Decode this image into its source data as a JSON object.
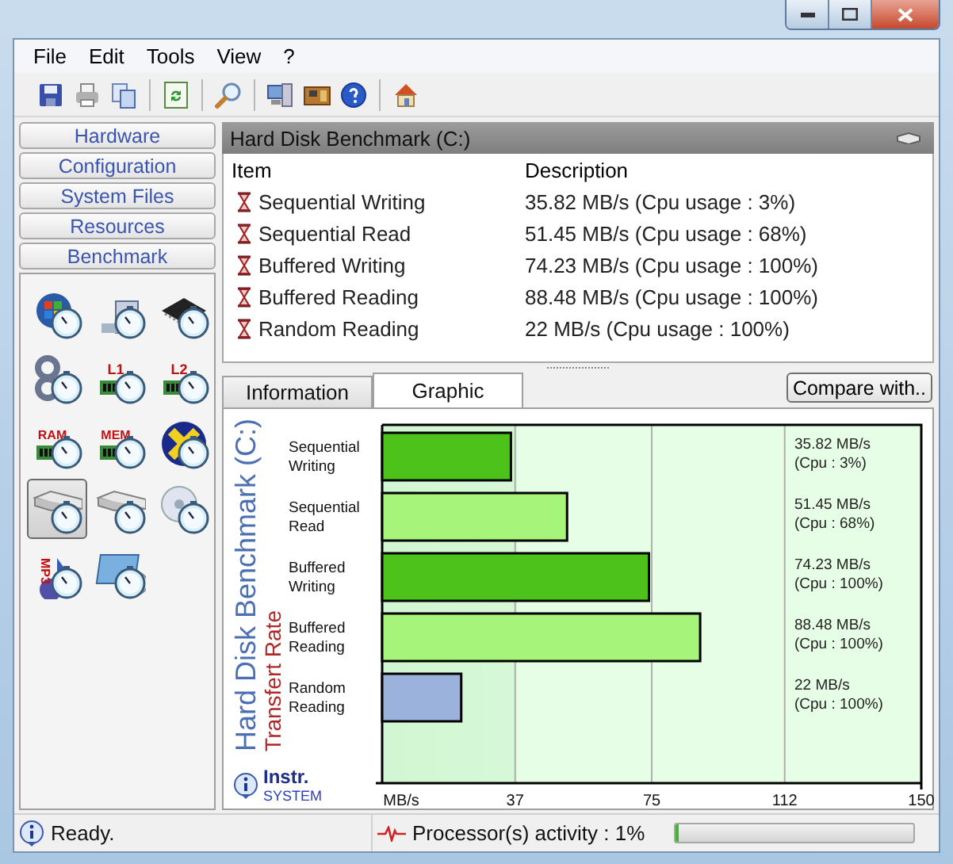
{
  "menu": [
    "File",
    "Edit",
    "Tools",
    "View",
    "?"
  ],
  "toolbar": [
    {
      "kind": "save"
    },
    {
      "kind": "print"
    },
    {
      "kind": "copy"
    },
    {
      "kind": "separator"
    },
    {
      "kind": "refresh"
    },
    {
      "kind": "separator"
    },
    {
      "kind": "search"
    },
    {
      "kind": "separator"
    },
    {
      "kind": "network"
    },
    {
      "kind": "board"
    },
    {
      "kind": "help"
    },
    {
      "kind": "separator"
    },
    {
      "kind": "home"
    }
  ],
  "nav": [
    "Hardware",
    "Configuration",
    "System Files",
    "Resources",
    "Benchmark"
  ],
  "icons": [
    {
      "kind": "windows",
      "selected": false
    },
    {
      "kind": "computer",
      "selected": false
    },
    {
      "kind": "chip",
      "selected": false
    },
    {
      "kind": "gears",
      "selected": false
    },
    {
      "kind": "memory",
      "label": "L1",
      "selected": false
    },
    {
      "kind": "memory",
      "label": "L2",
      "selected": false
    },
    {
      "kind": "memory",
      "label": "RAM",
      "selected": false
    },
    {
      "kind": "memory",
      "label": "MEM",
      "selected": false
    },
    {
      "kind": "xmark",
      "selected": false
    },
    {
      "kind": "drive",
      "selected": true
    },
    {
      "kind": "drive",
      "selected": false
    },
    {
      "kind": "disc",
      "selected": false
    },
    {
      "kind": "music",
      "label": "MP3",
      "selected": false
    },
    {
      "kind": "desktop",
      "selected": false
    }
  ],
  "panel": {
    "title": "Hard Disk Benchmark (C:)",
    "columns": [
      "Item",
      "Description"
    ],
    "rows": [
      {
        "item": "Sequential Writing",
        "description": "35.82 MB/s (Cpu usage : 3%)"
      },
      {
        "item": "Sequential Read",
        "description": "51.45 MB/s  (Cpu usage : 68%)"
      },
      {
        "item": "Buffered Writing",
        "description": "74.23 MB/s  (Cpu usage : 100%)"
      },
      {
        "item": "Buffered Reading",
        "description": "88.48 MB/s  (Cpu usage : 100%)"
      },
      {
        "item": "Random Reading",
        "description": "22 MB/s  (Cpu usage : 100%)"
      }
    ]
  },
  "tabs": [
    {
      "label": "Information",
      "selected": false
    },
    {
      "label": "Graphic",
      "selected": true
    }
  ],
  "compare_button": "Compare with..",
  "chart": {
    "chart_data": {
      "type": "bar",
      "orientation": "horizontal",
      "title": "Hard Disk Benchmark (C:)",
      "ylabel": "Transfert Rate",
      "categories": [
        "Sequential Writing",
        "Sequential Read",
        "Buffered Writing",
        "Buffered Reading",
        "Random Reading"
      ],
      "series": [
        {
          "color": "#4cc21a",
          "values": [
            35.82,
            null,
            74.23,
            null,
            null
          ]
        },
        {
          "color": "#a6f47a",
          "values": [
            null,
            51.45,
            null,
            88.48,
            null
          ]
        },
        {
          "color": "#9ab2dc",
          "values": [
            null,
            null,
            null,
            null,
            22
          ]
        }
      ],
      "xlim": [
        0,
        150
      ],
      "grid": true,
      "xticks": [
        {
          "value": 0,
          "label": "MB/s"
        },
        37,
        75,
        112,
        150
      ]
    },
    "notes": [
      {
        "rate": "35.82  MB/s",
        "cpu": "(Cpu : 3%)"
      },
      {
        "rate": "51.45  MB/s",
        "cpu": "(Cpu : 68%)"
      },
      {
        "rate": "74.23  MB/s",
        "cpu": "(Cpu : 100%)"
      },
      {
        "rate": "88.48  MB/s",
        "cpu": "(Cpu : 100%)"
      },
      {
        "rate": "22 MB/s",
        "cpu": "(Cpu : 100%)"
      }
    ],
    "brand": {
      "name": "Instr.",
      "sub": "SYSTEM"
    }
  },
  "status": {
    "text": "Ready.",
    "activity": "Processor(s) activity : 1%",
    "level": 0.01
  }
}
